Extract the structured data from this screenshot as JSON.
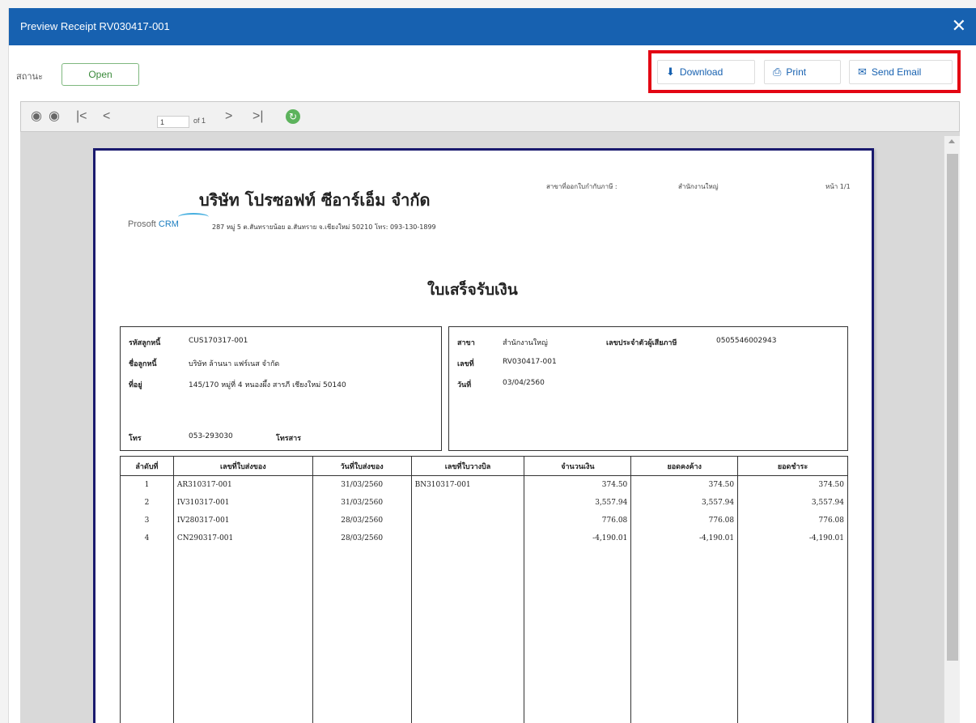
{
  "window": {
    "title": "Preview Receipt RV030417-001",
    "close_glyph": "✕"
  },
  "status": {
    "label": "สถานะ",
    "value": "Open"
  },
  "actions": {
    "download": {
      "label": "Download",
      "icon": "download-icon",
      "glyph": "⬇"
    },
    "print": {
      "label": "Print",
      "icon": "printer-icon",
      "glyph": "⎙"
    },
    "email": {
      "label": "Send Email",
      "icon": "envelope-icon",
      "glyph": "✉"
    }
  },
  "viewer": {
    "page": "1",
    "of": "of 1",
    "icons": {
      "prev_circle": "◉",
      "next_circle": "◉",
      "first": "|<",
      "prev": "<",
      "next": ">",
      "last": ">|",
      "refresh": "↻"
    }
  },
  "report": {
    "branch_label": "สาขาที่ออกใบกำกับภาษี :",
    "branch_value": "สำนักงานใหญ่",
    "page_label": "หน้า 1/1",
    "company": "บริษัท โปรซอฟท์ ซีอาร์เอ็ม จำกัด",
    "logo_prefix": "Prosoft",
    "logo_suffix": "CRM",
    "address": "287 หมู่ 5 ต.สันทรายน้อย อ.สันทราย จ.เชียงใหม่ 50210 โทร: 093-130-1899",
    "doc_title": "ใบเสร็จรับเงิน",
    "customer": {
      "code_label": "รหัสลูกหนี้",
      "code": "CUS170317-001",
      "name_label": "ชื่อลูกหนี้",
      "name": "บริษัท ล้านนา แฟร์เนส จำกัด",
      "addr_label": "ที่อยู่",
      "addr": "145/170 หมู่ที่ 4 หนองผึ้ง สารภี เชียงใหม่ 50140",
      "tel_label": "โทร",
      "tel": "053-293030",
      "fax_label": "โทรสาร",
      "fax": ""
    },
    "doc": {
      "branch_label": "สาขา",
      "branch": "สำนักงานใหญ่",
      "taxid_label": "เลขประจำตัวผู้เสียภาษี",
      "taxid": "0505546002943",
      "no_label": "เลขที่",
      "no": "RV030417-001",
      "date_label": "วันที่",
      "date": "03/04/2560"
    },
    "table": {
      "headers": [
        "ลำดับที่",
        "เลขที่ใบส่งของ",
        "วันที่ใบส่งของ",
        "เลขที่ใบวางบิล",
        "จำนวนเงิน",
        "ยอดคงค้าง",
        "ยอดชำระ"
      ],
      "rows": [
        [
          "1",
          "AR310317-001",
          "31/03/2560",
          "BN310317-001",
          "374.50",
          "374.50",
          "374.50"
        ],
        [
          "2",
          "IV310317-001",
          "31/03/2560",
          "",
          "3,557.94",
          "3,557.94",
          "3,557.94"
        ],
        [
          "3",
          "IV280317-001",
          "28/03/2560",
          "",
          "776.08",
          "776.08",
          "776.08"
        ],
        [
          "4",
          "CN290317-001",
          "28/03/2560",
          "",
          "-4,190.01",
          "-4,190.01",
          "-4,190.01"
        ]
      ]
    }
  }
}
